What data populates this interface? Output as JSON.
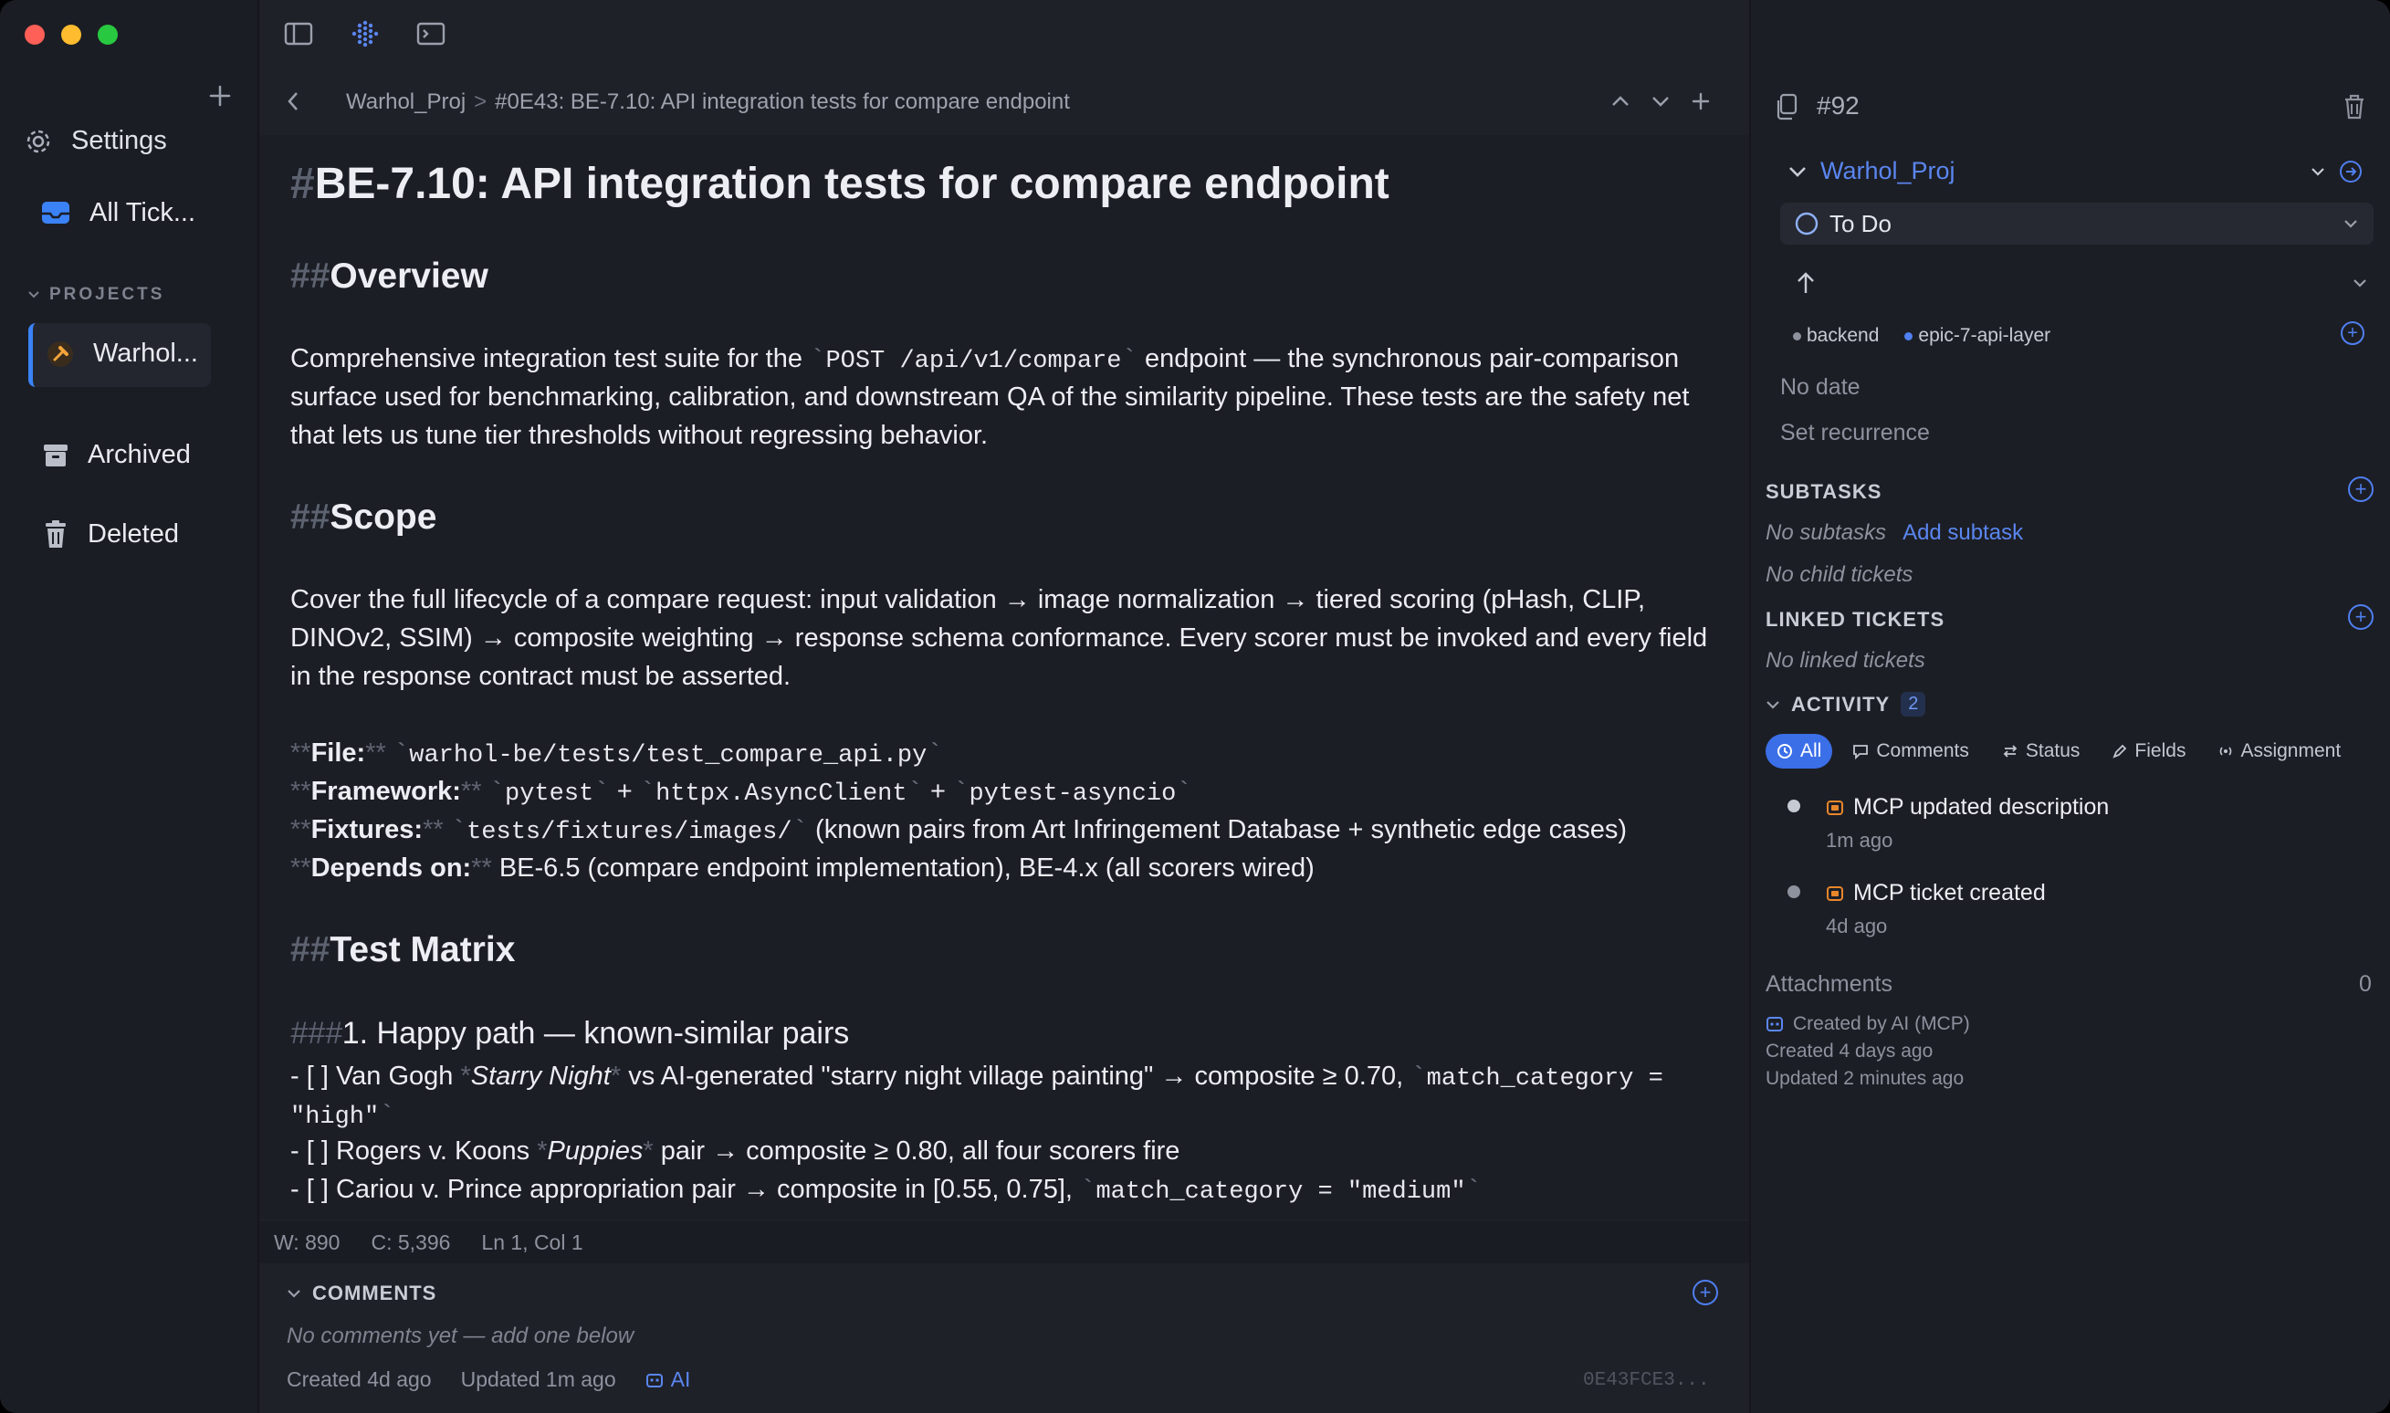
{
  "sidebar": {
    "settings_label": "Settings",
    "all_tickets_label": "All Tick...",
    "projects_header": "PROJECTS",
    "project_label": "Warhol...",
    "archived_label": "Archived",
    "deleted_label": "Deleted"
  },
  "breadcrumb": {
    "project": "Warhol_Proj",
    "separator": ">",
    "ticket": "#0E43: BE-7.10: API integration tests for compare endpoint"
  },
  "doc": {
    "title_hash": "#",
    "title": "BE-7.10: API integration tests for compare endpoint",
    "h2_hash": "##",
    "h3_hash": "###",
    "overview_heading": "Overview",
    "overview_p1_a": "Comprehensive integration test suite for the ",
    "overview_code": "POST /api/v1/compare",
    "overview_p1_b": " endpoint — the synchronous pair-comparison",
    "overview_p2": "surface used for benchmarking, calibration, and downstream QA of the similarity pipeline. These tests are the safety net",
    "overview_p3": "that lets us tune tier thresholds without regressing behavior.",
    "scope_heading": "Scope",
    "scope_p1": "Cover the full lifecycle of a compare request: input validation → image normalization → tiered scoring (pHash, CLIP,",
    "scope_p2": "DINOv2, SSIM) → composite weighting → response schema conformance. Every scorer must be invoked and every field",
    "scope_p3": "in the response contract must be asserted.",
    "bold_marker": "**",
    "backtick": "`",
    "file_label": "File:",
    "file_value": "warhol-be/tests/test_compare_api.py",
    "framework_label": "Framework:",
    "framework_v1": "pytest",
    "framework_v2": "httpx.AsyncClient",
    "framework_v3": "pytest-asyncio",
    "plus": " + ",
    "fixtures_label": "Fixtures:",
    "fixtures_code": "tests/fixtures/images/",
    "fixtures_rest": " (known pairs from Art Infringement Database + synthetic edge cases)",
    "depends_label": "Depends on:",
    "depends_value": " BE-6.5 (compare endpoint implementation), BE-4.x (all scorers wired)",
    "matrix_heading": "Test Matrix",
    "happy_heading": "1. Happy path — known-similar pairs",
    "item1_a": "- [ ] Van Gogh ",
    "item1_em_mark": "*",
    "item1_em": "Starry Night",
    "item1_b": " vs AI-generated \"starry night village painting\" → composite ≥ 0.70, ",
    "item1_code": "match_category =",
    "item1_code2": "\"high\"",
    "item2_a": "- [ ] Rogers v. Koons ",
    "item2_em": "Puppies",
    "item2_b": " pair → composite ≥ 0.80, all four scorers fire",
    "item3_a": "- [ ] Cariou v. Prince appropriation pair → composite in [0.55, 0.75], ",
    "item3_code": "match_category = \"medium\""
  },
  "status_bar": {
    "words": "W: 890",
    "chars": "C: 5,396",
    "position": "Ln 1, Col 1"
  },
  "comments": {
    "header": "COMMENTS",
    "empty": "No comments yet — add one below",
    "created": "Created 4d ago",
    "updated": "Updated 1m ago",
    "ai_label": "AI",
    "hash": "0E43FCE3..."
  },
  "detail": {
    "number": "#92",
    "project": "Warhol_Proj",
    "status": "To Do",
    "tags": [
      "backend",
      "epic-7-api-layer"
    ],
    "date": "No date",
    "recurrence": "Set recurrence",
    "subtasks_header": "SUBTASKS",
    "no_subtasks": "No subtasks",
    "add_subtask": "Add subtask",
    "no_child": "No child tickets",
    "linked_header": "LINKED TICKETS",
    "no_linked": "No linked tickets",
    "activity_header": "ACTIVITY",
    "activity_count": "2",
    "filters": {
      "all": "All",
      "comments": "Comments",
      "status": "Status",
      "fields": "Fields",
      "assignments": "Assignment"
    },
    "activity": [
      {
        "text": "MCP updated description",
        "time": "1m ago"
      },
      {
        "text": "MCP ticket created",
        "time": "4d ago"
      }
    ],
    "attachments_label": "Attachments",
    "attachments_count": "0",
    "created_by": "Created by AI (MCP)",
    "created": "Created 4 days ago",
    "updated": "Updated 2 minutes ago"
  },
  "colors": {
    "accent": "#4f7ff0",
    "tag_backend": "#8d929e",
    "tag_epic": "#4f7ff0",
    "activity_icon": "#e8862a"
  }
}
